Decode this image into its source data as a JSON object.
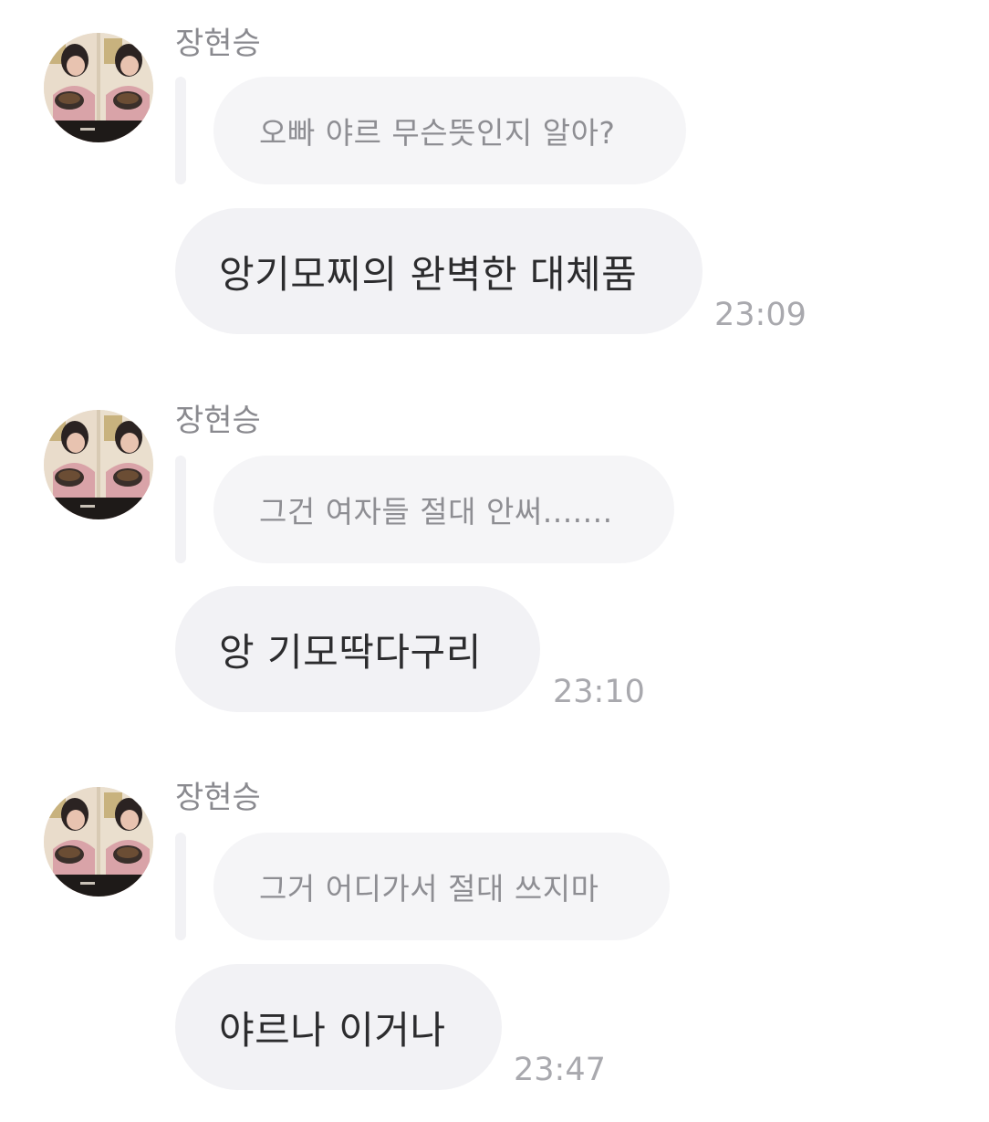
{
  "messages": [
    {
      "sender": "장현승",
      "reply_to": "오빠 야르 무슨뜻인지 알아?",
      "text": "앙기모찌의 완벽한 대체품",
      "time": "23:09"
    },
    {
      "sender": "장현승",
      "reply_to": "그건 여자들 절대 안써.......",
      "text": "앙 기모딱다구리",
      "time": "23:10"
    },
    {
      "sender": "장현승",
      "reply_to": "그거 어디가서 절대 쓰지마",
      "text": "야르나 이거나",
      "time": "23:47"
    }
  ],
  "colors": {
    "background": "#ffffff",
    "bubble": "#f2f2f5",
    "reply_bubble": "#f5f5f7",
    "name_text": "#8a8a8f",
    "reply_text": "#8e8e93",
    "main_text": "#2c2c2e",
    "time_text": "#a9a9ae"
  },
  "icons": {
    "avatar": "profile-photo-avatar"
  }
}
